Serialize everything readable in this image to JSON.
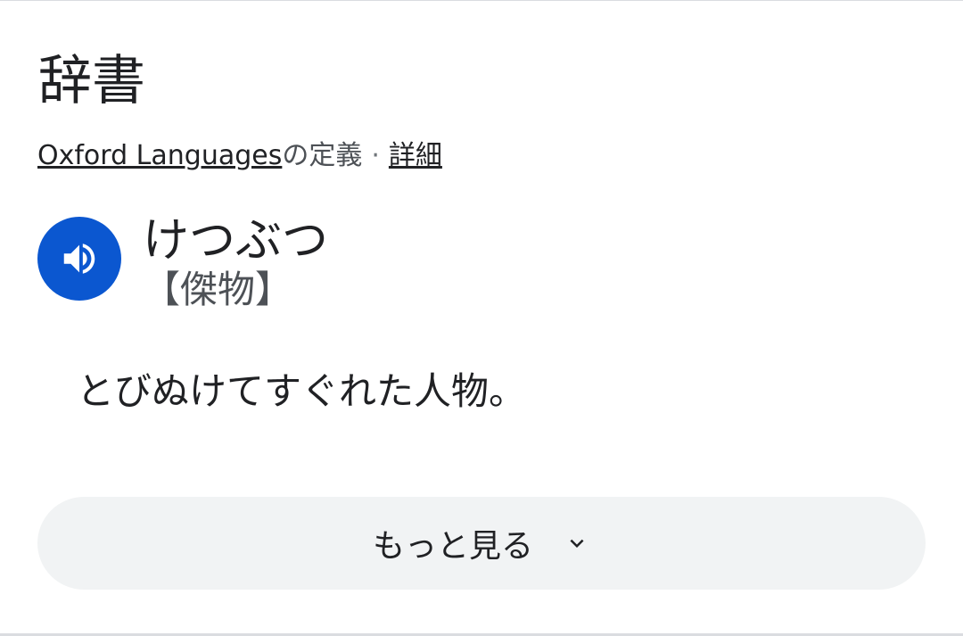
{
  "dictionary": {
    "title": "辞書",
    "source": {
      "link_text": "Oxford Languages",
      "suffix": "の定義",
      "separator": "·",
      "details_label": "詳細"
    },
    "entry": {
      "speaker_icon": "volume-up-icon",
      "reading": "けつぶつ",
      "kanji": "【傑物】",
      "definition": "とびぬけてすぐれた人物。"
    },
    "more_button": {
      "label": "もっと見る",
      "icon": "chevron-down-icon"
    }
  },
  "colors": {
    "accent": "#0b57d0",
    "button_bg": "#f1f3f4",
    "text_primary": "#202124",
    "text_secondary": "#4d5156"
  }
}
